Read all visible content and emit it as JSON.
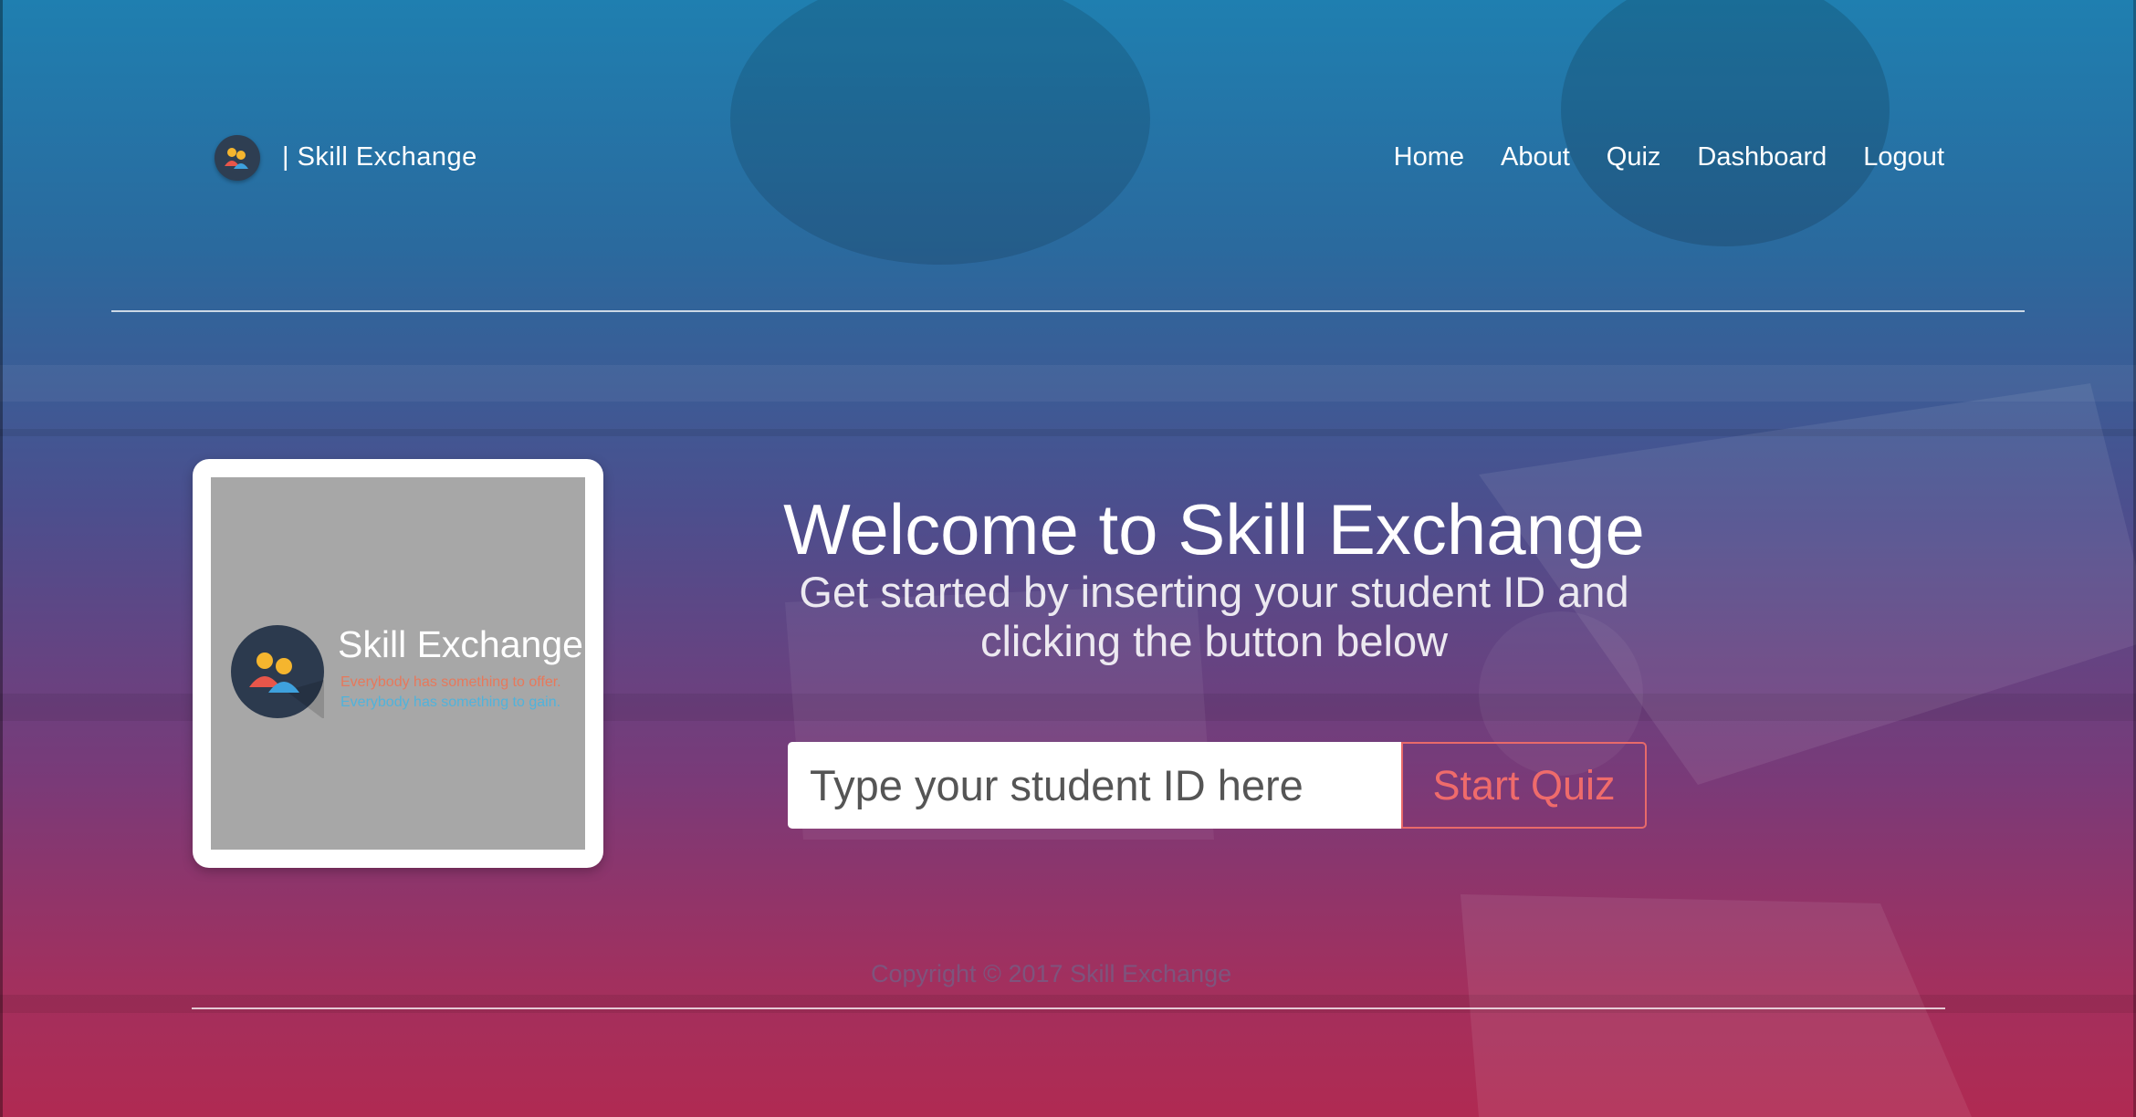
{
  "colors": {
    "gradient_top": "#1f7fb0",
    "gradient_bottom": "#b02a52",
    "accent": "#ef6b6b",
    "logo_circle": "#2c3a4e",
    "logo_box": "#a7a7a7"
  },
  "header": {
    "brand": {
      "icon": "people-icon",
      "label": "| Skill Exchange"
    },
    "nav": [
      {
        "label": "Home"
      },
      {
        "label": "About"
      },
      {
        "label": "Quiz"
      },
      {
        "label": "Dashboard"
      },
      {
        "label": "Logout"
      }
    ]
  },
  "logo_card": {
    "icon": "people-icon",
    "title": "Skill Exchange",
    "tagline_1": "Everybody has something to offer.",
    "tagline_2": "Everybody has something to gain."
  },
  "hero": {
    "title": "Welcome to Skill Exchange",
    "subtitle_line1": "Get started by inserting your student ID and",
    "subtitle_line2": "clicking the button below"
  },
  "form": {
    "input_placeholder": "Type your student ID here",
    "input_value": "",
    "button_label": "Start Quiz"
  },
  "footer": {
    "copyright": "Copyright © 2017 Skill Exchange"
  }
}
